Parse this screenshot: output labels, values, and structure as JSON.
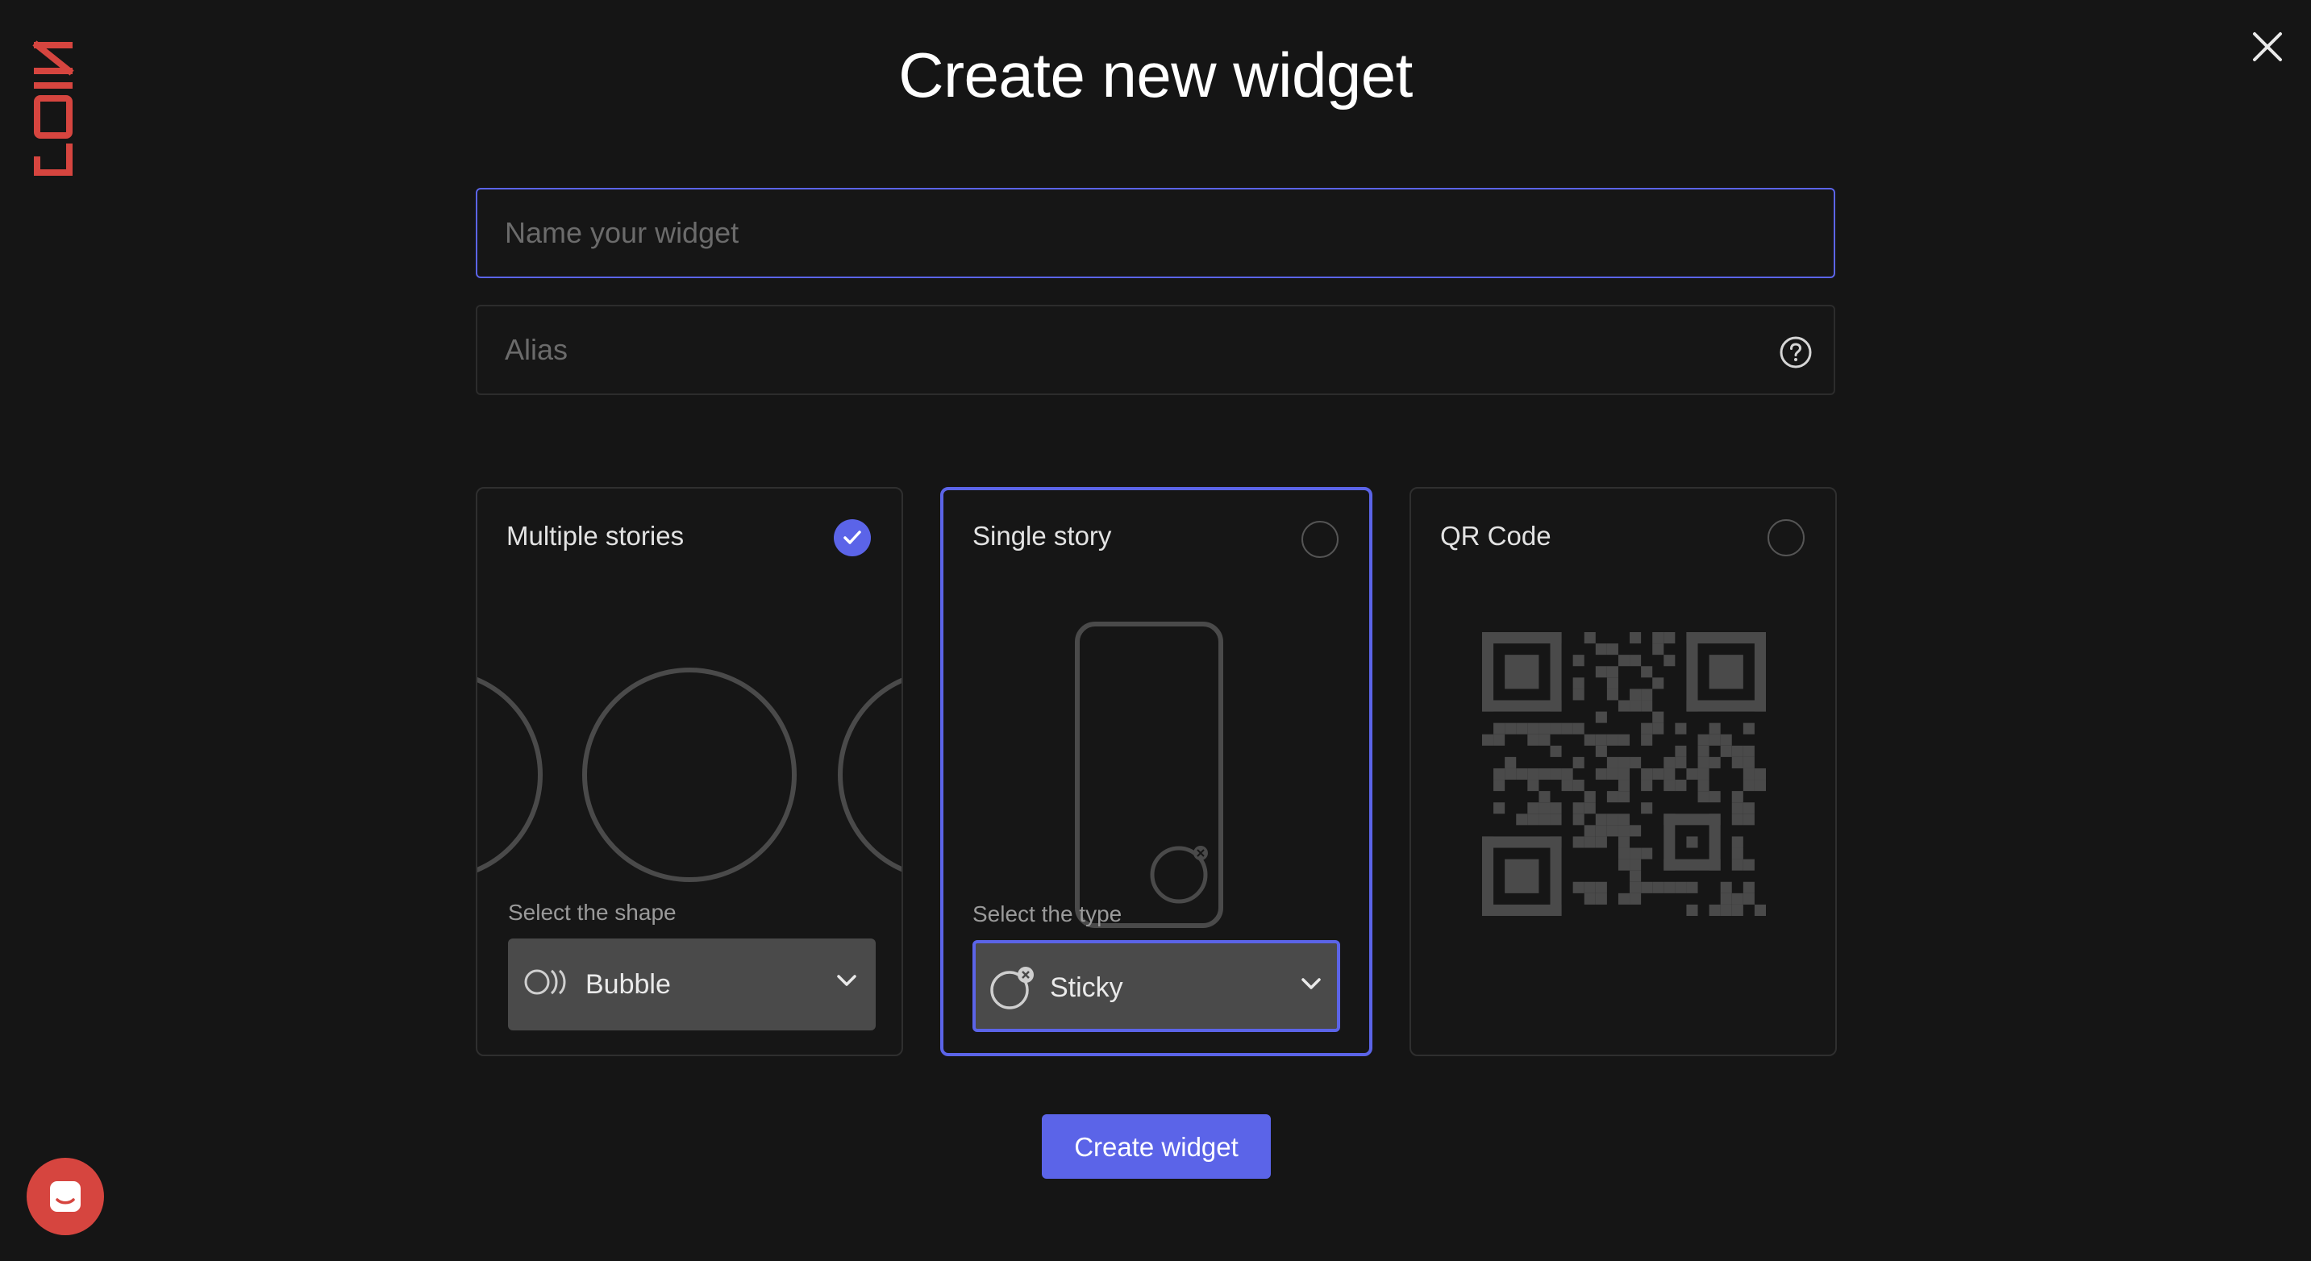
{
  "brand": {
    "logo_text": "JOIN",
    "accent": "#d6453f"
  },
  "header": {
    "title": "Create new widget",
    "close_icon": "close-icon"
  },
  "form": {
    "name_placeholder": "Name your widget",
    "name_value": "",
    "alias_placeholder": "Alias",
    "alias_value": ""
  },
  "cards": {
    "multiple": {
      "title": "Multiple stories",
      "checked": true,
      "select_label": "Select the shape",
      "selected_value": "Bubble"
    },
    "single": {
      "title": "Single story",
      "checked": false,
      "select_label": "Select the type",
      "selected_value": "Sticky"
    },
    "qr": {
      "title": "QR Code",
      "checked": false
    }
  },
  "actions": {
    "create_label": "Create widget"
  },
  "colors": {
    "accent": "#5b64e8",
    "background": "#151515",
    "chat": "#d6453f"
  }
}
